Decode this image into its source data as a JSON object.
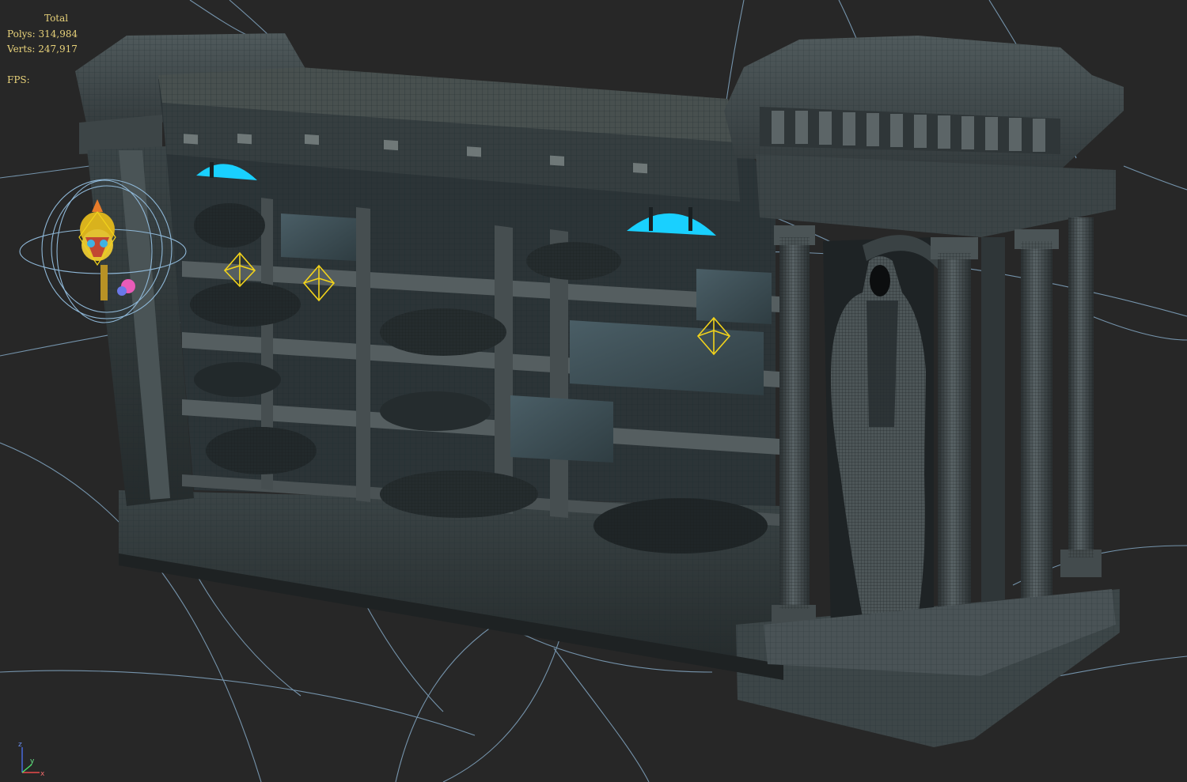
{
  "stats": {
    "title": "Total",
    "polys_label": "Polys:",
    "polys_value": "314,984",
    "verts_label": "Verts:",
    "verts_value": "247,917",
    "fps_label": "FPS:"
  },
  "axis_gizmo": {
    "z": "z",
    "y": "y",
    "x": "x"
  },
  "colors": {
    "background": "#272727",
    "stats_text": "#e8d27a",
    "wireframe": "#8fb8d8",
    "glow_cyan": "#19d0ff",
    "helper_yellow": "#f2d31b"
  },
  "scene": {
    "objects": [
      "mausoleum-model",
      "hooded-statue",
      "columns",
      "light-helpers",
      "torch-helper",
      "light-radius-splines"
    ]
  }
}
